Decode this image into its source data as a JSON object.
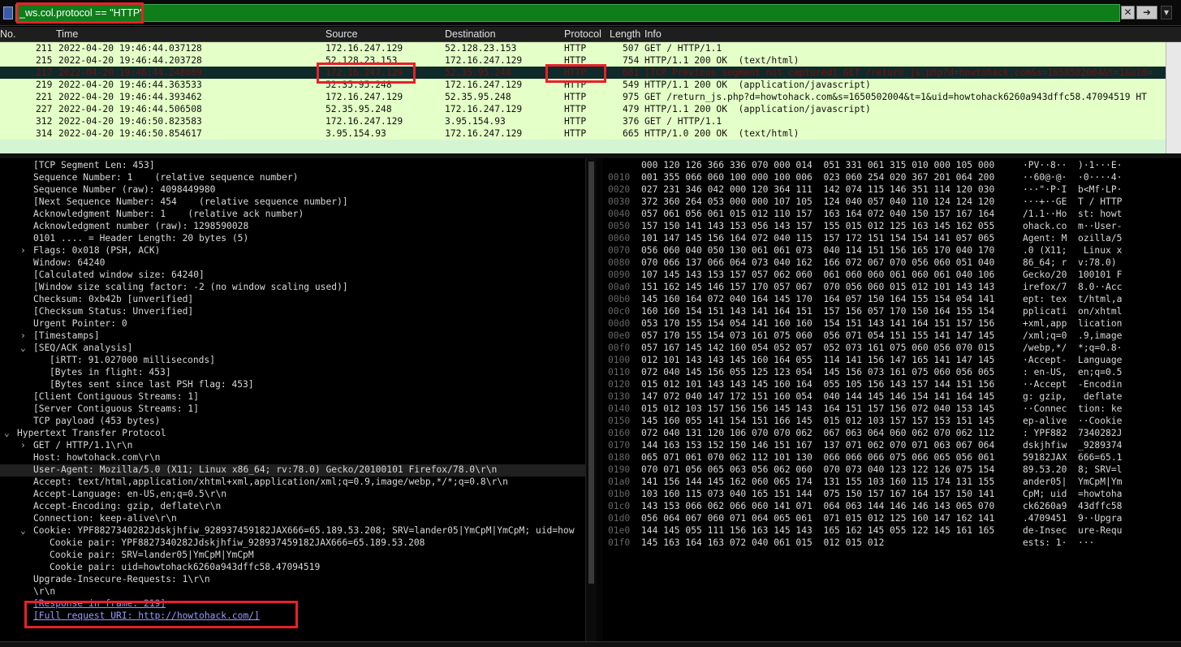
{
  "filter": {
    "value": "_ws.col.protocol == \"HTTP\"",
    "clear_icon": "x-icon",
    "apply_icon": "arrow-right-icon",
    "dropdown_icon": "chevron-down-icon"
  },
  "packet_list": {
    "headers": [
      "No.",
      "Time",
      "Source",
      "Destination",
      "Protocol",
      "Length",
      "Info"
    ],
    "rows": [
      {
        "no": "211",
        "time": "2022-04-20 19:46:44.037128",
        "src": "172.16.247.129",
        "dst": "52.128.23.153",
        "proto": "HTTP",
        "len": "507",
        "info": "GET / HTTP/1.1"
      },
      {
        "no": "215",
        "time": "2022-04-20 19:46:44.203728",
        "src": "52.128.23.153",
        "dst": "172.16.247.129",
        "proto": "HTTP",
        "len": "754",
        "info": "HTTP/1.1 200 OK  (text/html)"
      },
      {
        "no": "217",
        "time": "2022-04-20 19:46:44.248869",
        "src": "172.16.247.129",
        "dst": "52.35.95.248",
        "proto": "HTTP",
        "len": "681",
        "info": "[TCP Previous segment not captured] GET /return_js.php?d=howtohack.com&s=1650502004&t=1&uid=",
        "selected": true
      },
      {
        "no": "219",
        "time": "2022-04-20 19:46:44.363533",
        "src": "52.35.95.248",
        "dst": "172.16.247.129",
        "proto": "HTTP",
        "len": "549",
        "info": "HTTP/1.1 200 OK  (application/javascript)"
      },
      {
        "no": "221",
        "time": "2022-04-20 19:46:44.393462",
        "src": "172.16.247.129",
        "dst": "52.35.95.248",
        "proto": "HTTP",
        "len": "975",
        "info": "GET /return_js.php?d=howtohack.com&s=1650502004&t=1&uid=howtohack6260a943dffc58.47094519 HT"
      },
      {
        "no": "227",
        "time": "2022-04-20 19:46:44.506508",
        "src": "52.35.95.248",
        "dst": "172.16.247.129",
        "proto": "HTTP",
        "len": "479",
        "info": "HTTP/1.1 200 OK  (application/javascript)"
      },
      {
        "no": "312",
        "time": "2022-04-20 19:46:50.823583",
        "src": "172.16.247.129",
        "dst": "3.95.154.93",
        "proto": "HTTP",
        "len": "376",
        "info": "GET / HTTP/1.1"
      },
      {
        "no": "314",
        "time": "2022-04-20 19:46:50.854617",
        "src": "3.95.154.93",
        "dst": "172.16.247.129",
        "proto": "HTTP",
        "len": "665",
        "info": "HTTP/1.0 200 OK  (text/html)"
      }
    ]
  },
  "details": [
    {
      "indent": 2,
      "arrow": "",
      "text": "[TCP Segment Len: 453]"
    },
    {
      "indent": 2,
      "arrow": "",
      "text": "Sequence Number: 1    (relative sequence number)"
    },
    {
      "indent": 2,
      "arrow": "",
      "text": "Sequence Number (raw): 4098449980"
    },
    {
      "indent": 2,
      "arrow": "",
      "text": "[Next Sequence Number: 454    (relative sequence number)]"
    },
    {
      "indent": 2,
      "arrow": "",
      "text": "Acknowledgment Number: 1    (relative ack number)"
    },
    {
      "indent": 2,
      "arrow": "",
      "text": "Acknowledgment number (raw): 1298590028"
    },
    {
      "indent": 2,
      "arrow": "",
      "text": "0101 .... = Header Length: 20 bytes (5)"
    },
    {
      "indent": 2,
      "arrow": "›",
      "text": "Flags: 0x018 (PSH, ACK)"
    },
    {
      "indent": 2,
      "arrow": "",
      "text": "Window: 64240"
    },
    {
      "indent": 2,
      "arrow": "",
      "text": "[Calculated window size: 64240]"
    },
    {
      "indent": 2,
      "arrow": "",
      "text": "[Window size scaling factor: -2 (no window scaling used)]"
    },
    {
      "indent": 2,
      "arrow": "",
      "text": "Checksum: 0xb42b [unverified]"
    },
    {
      "indent": 2,
      "arrow": "",
      "text": "[Checksum Status: Unverified]"
    },
    {
      "indent": 2,
      "arrow": "",
      "text": "Urgent Pointer: 0"
    },
    {
      "indent": 2,
      "arrow": "›",
      "text": "[Timestamps]"
    },
    {
      "indent": 2,
      "arrow": "⌄",
      "text": "[SEQ/ACK analysis]"
    },
    {
      "indent": 3,
      "arrow": "",
      "text": "[iRTT: 91.027000 milliseconds]"
    },
    {
      "indent": 3,
      "arrow": "",
      "text": "[Bytes in flight: 453]"
    },
    {
      "indent": 3,
      "arrow": "",
      "text": "[Bytes sent since last PSH flag: 453]"
    },
    {
      "indent": 2,
      "arrow": "",
      "text": "[Client Contiguous Streams: 1]"
    },
    {
      "indent": 2,
      "arrow": "",
      "text": "[Server Contiguous Streams: 1]"
    },
    {
      "indent": 2,
      "arrow": "",
      "text": "TCP payload (453 bytes)"
    },
    {
      "indent": 1,
      "arrow": "⌄",
      "text": "Hypertext Transfer Protocol"
    },
    {
      "indent": 2,
      "arrow": "›",
      "text": "GET / HTTP/1.1\\r\\n"
    },
    {
      "indent": 2,
      "arrow": "",
      "text": "Host: howtohack.com\\r\\n"
    },
    {
      "indent": 2,
      "arrow": "",
      "text": "User-Agent: Mozilla/5.0 (X11; Linux x86_64; rv:78.0) Gecko/20100101 Firefox/78.0\\r\\n",
      "current": true
    },
    {
      "indent": 2,
      "arrow": "",
      "text": "Accept: text/html,application/xhtml+xml,application/xml;q=0.9,image/webp,*/*;q=0.8\\r\\n"
    },
    {
      "indent": 2,
      "arrow": "",
      "text": "Accept-Language: en-US,en;q=0.5\\r\\n"
    },
    {
      "indent": 2,
      "arrow": "",
      "text": "Accept-Encoding: gzip, deflate\\r\\n"
    },
    {
      "indent": 2,
      "arrow": "",
      "text": "Connection: keep-alive\\r\\n"
    },
    {
      "indent": 2,
      "arrow": "⌄",
      "text": "Cookie: YPF8827340282Jdskjhfiw_928937459182JAX666=65.189.53.208; SRV=lander05|YmCpM|YmCpM; uid=how"
    },
    {
      "indent": 3,
      "arrow": "",
      "text": "Cookie pair: YPF8827340282Jdskjhfiw_928937459182JAX666=65.189.53.208"
    },
    {
      "indent": 3,
      "arrow": "",
      "text": "Cookie pair: SRV=lander05|YmCpM|YmCpM"
    },
    {
      "indent": 3,
      "arrow": "",
      "text": "Cookie pair: uid=howtohack6260a943dffc58.47094519"
    },
    {
      "indent": 2,
      "arrow": "",
      "text": "Upgrade-Insecure-Requests: 1\\r\\n"
    },
    {
      "indent": 2,
      "arrow": "",
      "text": "\\r\\n"
    },
    {
      "indent": 2,
      "arrow": "",
      "text": "[Response in frame: 219]",
      "link": true
    },
    {
      "indent": 2,
      "arrow": "",
      "text": "[Full request URI: http://howtohack.com/]",
      "link": true
    }
  ],
  "bytes": [
    {
      "off": "",
      "hex": "000 120 126 366 336 070 000 014  051 331 061 315 010 000 105 000",
      "ascii": "·PV··8··  )·1···E·"
    },
    {
      "off": "0010",
      "hex": "001 355 066 060 100 000 100 006  023 060 254 020 367 201 064 200",
      "ascii": "··60@·@·  ·0····4·"
    },
    {
      "off": "0020",
      "hex": "027 231 346 042 000 120 364 111  142 074 115 146 351 114 120 030",
      "ascii": "···\"·P·I  b<Mf·LP·"
    },
    {
      "off": "0030",
      "hex": "372 360 264 053 000 000 107 105  124 040 057 040 110 124 124 120",
      "ascii": "···+··GE  T / HTTP"
    },
    {
      "off": "0040",
      "hex": "057 061 056 061 015 012 110 157  163 164 072 040 150 157 167 164",
      "ascii": "/1.1··Ho  st: howt"
    },
    {
      "off": "0050",
      "hex": "157 150 141 143 153 056 143 157  155 015 012 125 163 145 162 055",
      "ascii": "ohack.co  m··User-"
    },
    {
      "off": "0060",
      "hex": "101 147 145 156 164 072 040 115  157 172 151 154 154 141 057 065",
      "ascii": "Agent: M  ozilla/5"
    },
    {
      "off": "0070",
      "hex": "056 060 040 050 130 061 061 073  040 114 151 156 165 170 040 170",
      "ascii": ".0 (X11;   Linux x"
    },
    {
      "off": "0080",
      "hex": "070 066 137 066 064 073 040 162  166 072 067 070 056 060 051 040",
      "ascii": "86_64; r  v:78.0) "
    },
    {
      "off": "0090",
      "hex": "107 145 143 153 157 057 062 060  061 060 060 061 060 061 040 106",
      "ascii": "Gecko/20  100101 F"
    },
    {
      "off": "00a0",
      "hex": "151 162 145 146 157 170 057 067  070 056 060 015 012 101 143 143",
      "ascii": "irefox/7  8.0··Acc"
    },
    {
      "off": "00b0",
      "hex": "145 160 164 072 040 164 145 170  164 057 150 164 155 154 054 141",
      "ascii": "ept: tex  t/html,a"
    },
    {
      "off": "00c0",
      "hex": "160 160 154 151 143 141 164 151  157 156 057 170 150 164 155 154",
      "ascii": "pplicati  on/xhtml"
    },
    {
      "off": "00d0",
      "hex": "053 170 155 154 054 141 160 160  154 151 143 141 164 151 157 156",
      "ascii": "+xml,app  lication"
    },
    {
      "off": "00e0",
      "hex": "057 170 155 154 073 161 075 060  056 071 054 151 155 141 147 145",
      "ascii": "/xml;q=0  .9,image"
    },
    {
      "off": "00f0",
      "hex": "057 167 145 142 160 054 052 057  052 073 161 075 060 056 070 015",
      "ascii": "/webp,*/  *;q=0.8·"
    },
    {
      "off": "0100",
      "hex": "012 101 143 143 145 160 164 055  114 141 156 147 165 141 147 145",
      "ascii": "·Accept-  Language"
    },
    {
      "off": "0110",
      "hex": "072 040 145 156 055 125 123 054  145 156 073 161 075 060 056 065",
      "ascii": ": en-US,  en;q=0.5"
    },
    {
      "off": "0120",
      "hex": "015 012 101 143 143 145 160 164  055 105 156 143 157 144 151 156",
      "ascii": "··Accept  -Encodin"
    },
    {
      "off": "0130",
      "hex": "147 072 040 147 172 151 160 054  040 144 145 146 154 141 164 145",
      "ascii": "g: gzip,   deflate"
    },
    {
      "off": "0140",
      "hex": "015 012 103 157 156 156 145 143  164 151 157 156 072 040 153 145",
      "ascii": "··Connec  tion: ke"
    },
    {
      "off": "0150",
      "hex": "145 160 055 141 154 151 166 145  015 012 103 157 157 153 151 145",
      "ascii": "ep-alive  ··Cookie"
    },
    {
      "off": "0160",
      "hex": "072 040 131 120 106 070 070 062  067 063 064 060 062 070 062 112",
      "ascii": ": YPF882  7340282J"
    },
    {
      "off": "0170",
      "hex": "144 163 153 152 150 146 151 167  137 071 062 070 071 063 067 064",
      "ascii": "dskjhfiw  _9289374"
    },
    {
      "off": "0180",
      "hex": "065 071 061 070 062 112 101 130  066 066 066 075 066 065 056 061",
      "ascii": "59182JAX  666=65.1"
    },
    {
      "off": "0190",
      "hex": "070 071 056 065 063 056 062 060  070 073 040 123 122 126 075 154",
      "ascii": "89.53.20  8; SRV=l"
    },
    {
      "off": "01a0",
      "hex": "141 156 144 145 162 060 065 174  131 155 103 160 115 174 131 155",
      "ascii": "ander05|  YmCpM|Ym"
    },
    {
      "off": "01b0",
      "hex": "103 160 115 073 040 165 151 144  075 150 157 167 164 157 150 141",
      "ascii": "CpM; uid  =howtoha"
    },
    {
      "off": "01c0",
      "hex": "143 153 066 062 066 060 141 071  064 063 144 146 146 143 065 070",
      "ascii": "ck6260a9  43dffc58"
    },
    {
      "off": "01d0",
      "hex": "056 064 067 060 071 064 065 061  071 015 012 125 160 147 162 141",
      "ascii": ".4709451  9··Upgra"
    },
    {
      "off": "01e0",
      "hex": "144 145 055 111 156 163 145 143  165 162 145 055 122 145 161 165",
      "ascii": "de-Insec  ure-Requ"
    },
    {
      "off": "01f0",
      "hex": "145 163 164 163 072 040 061 015  012 015 012",
      "ascii": "ests: 1·  ···"
    }
  ],
  "colors": {
    "filter_valid": "#0f7d1a",
    "row_bg": "#e4ffc7",
    "selected_row": "#0f2a2a",
    "annotation": "#e8202a",
    "link": "#9a9aff"
  }
}
